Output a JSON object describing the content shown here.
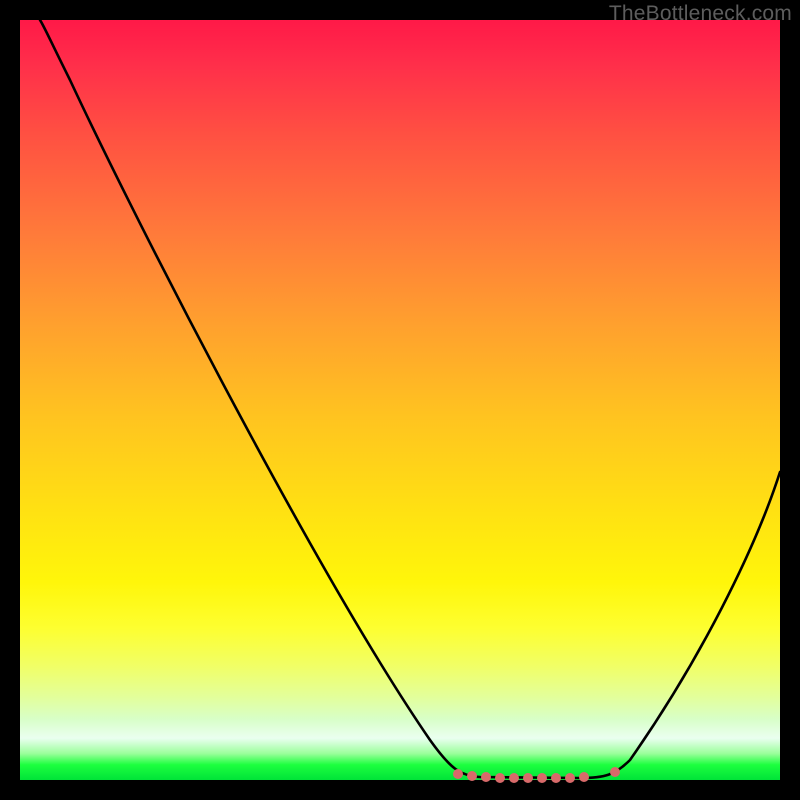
{
  "watermark": "TheBottleneck.com",
  "chart_data": {
    "type": "line",
    "title": "",
    "xlabel": "",
    "ylabel": "",
    "xlim": [
      0,
      100
    ],
    "ylim": [
      0,
      100
    ],
    "x": [
      0,
      3,
      10,
      20,
      30,
      40,
      50,
      56,
      60,
      64,
      68,
      72,
      76,
      80,
      84,
      88,
      92,
      96,
      100
    ],
    "values": [
      100,
      100,
      86,
      67,
      49,
      31,
      13,
      2,
      0,
      0,
      0,
      0,
      0,
      1,
      6,
      14,
      24,
      35,
      46
    ],
    "notes": "V-shaped bottleneck curve. y=0 is the optimal (green) band; higher y means more bottleneck (red). Minimum plateau roughly between x≈58 and x≈78.",
    "marker_region": {
      "x_start": 57,
      "x_end": 80,
      "color": "#d86a6a",
      "description": "salmon dots along the valley floor"
    },
    "background_gradient": {
      "orientation": "vertical",
      "stops": [
        {
          "pos": 0.0,
          "color": "#ff1948"
        },
        {
          "pos": 0.5,
          "color": "#ffc320"
        },
        {
          "pos": 0.8,
          "color": "#fdff30"
        },
        {
          "pos": 0.95,
          "color": "#eafff0"
        },
        {
          "pos": 1.0,
          "color": "#00e338"
        }
      ]
    }
  }
}
